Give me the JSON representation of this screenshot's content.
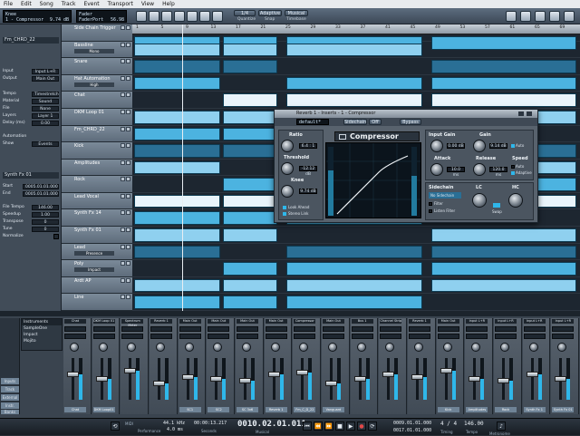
{
  "menu": [
    "File",
    "Edit",
    "Song",
    "Track",
    "Event",
    "Transport",
    "View",
    "Help"
  ],
  "toolbar": {
    "left_lcd_top": "Knee",
    "left_lcd_bottom": "1 - Compressor",
    "left_lcd_val": "9.74 dB",
    "mid_lcd_top": "Fader",
    "mid_lcd_bottom": "FaderPort",
    "mid_lcd_val": "56.98",
    "quantize_value": "1/4",
    "quantize_label": "Quantize",
    "snap_value": "Adaptive",
    "snap_label": "Snap",
    "timebase_value": "Musical",
    "timebase_label": "Timebase"
  },
  "inspector": {
    "channel_name": "Fm_CHRD_22",
    "input_label": "Input",
    "input_value": "Input L+R",
    "output_label": "Output",
    "output_value": "Main Out",
    "tempo_label": "Tempo",
    "tempo_value": "Timestretch",
    "material_label": "Material",
    "material_value": "Sound",
    "file_label": "File",
    "file_value": "None",
    "layers_label": "Layers",
    "layers_value": "Layer 1",
    "delay_label": "Delay (ms)",
    "delay_value": "0.00",
    "automation_label": "Automation",
    "show_label": "Show",
    "show_value": "Events",
    "event_name": "Synth Fx 01",
    "start_label": "Start",
    "start_value": "0005.01.01.000",
    "end_label": "End",
    "end_value": "0005.01.01.000",
    "filetempo_label": "File Tempo",
    "filetempo_value": "146.00",
    "speedup_label": "Speedup",
    "speedup_value": "1.00",
    "transpose_label": "Transpose",
    "transpose_value": "0",
    "tune_label": "Tune",
    "tune_value": "0",
    "normalize_label": "Normalize"
  },
  "tracks": [
    {
      "name": "Side Chain Trigger",
      "sub": ""
    },
    {
      "name": "Bassline",
      "sub": "Mono"
    },
    {
      "name": "Snare",
      "sub": ""
    },
    {
      "name": "Hat Automation",
      "sub": "High"
    },
    {
      "name": "Chat",
      "sub": ""
    },
    {
      "name": "DKM Loop 01",
      "sub": ""
    },
    {
      "name": "Fm_CHRD_22",
      "sub": ""
    },
    {
      "name": "Kick",
      "sub": ""
    },
    {
      "name": "Amplitudes",
      "sub": ""
    },
    {
      "name": "Rock",
      "sub": ""
    },
    {
      "name": "Lead Vocal",
      "sub": ""
    },
    {
      "name": "Synth Fx 14",
      "sub": ""
    },
    {
      "name": "Synth Fx 01",
      "sub": ""
    },
    {
      "name": "Lead",
      "sub": "Presence"
    },
    {
      "name": "Poly",
      "sub": "Impact"
    },
    {
      "name": "Ardt AP",
      "sub": ""
    },
    {
      "name": "Line",
      "sub": ""
    }
  ],
  "ruler": [
    "1",
    "5",
    "9",
    "13",
    "17",
    "21",
    "25",
    "29",
    "33",
    "37",
    "41",
    "45",
    "49",
    "53",
    "57",
    "61",
    "65",
    "69"
  ],
  "compressor": {
    "window_title": "Reverb 1 - Inserts - 1 - Compressor",
    "preset": "default*",
    "sidechain_btn": "Sidechain",
    "off_btn": "Off",
    "bypass_btn": "Bypass",
    "brand": "Compressor",
    "ratio_label": "Ratio",
    "ratio_value": "6.4 : 1",
    "threshold_label": "Threshold",
    "threshold_value": "-12.12 dB",
    "knee_label": "Knee",
    "knee_value": "9.74 dB",
    "look_ahead": "Look Ahead",
    "stereo_link": "Stereo Link",
    "input_gain_label": "Input Gain",
    "input_gain_value": "0.00 dB",
    "gain_label": "Gain",
    "gain_value": "9.14 dB",
    "auto_label": "Auto",
    "attack_label": "Attack",
    "attack_value": "10.0 ms",
    "release_label": "Release",
    "release_value": "120.0 ms",
    "speed_label": "Speed",
    "speed_auto": "Auto",
    "speed_adaptive": "Adaptive",
    "sidechain_label": "Sidechain",
    "no_sidechain": "No Sidechain",
    "filter_label": "Filter",
    "listen_filter": "Listen Filter",
    "lc_label": "LC",
    "hc_label": "HC",
    "swap_label": "Swap"
  },
  "mixer": {
    "left_panel": [
      "Instruments",
      "SampleOne",
      "Impact",
      "Mojito"
    ],
    "strips": [
      {
        "name": "Chat",
        "foot": "Chat",
        "level": 0.6
      },
      {
        "name": "DKM Loop 01",
        "foot": "DKM Loop01",
        "level": 0.5
      },
      {
        "name": "Spectrum Meter",
        "foot": "",
        "level": 0.7
      },
      {
        "name": "Reverb 1",
        "foot": "",
        "level": 0.4
      },
      {
        "name": "Main Out",
        "foot": "SC1",
        "level": 0.55
      },
      {
        "name": "Main Out",
        "foot": "SC2",
        "level": 0.5
      },
      {
        "name": "Main Out",
        "foot": "SC 3x6",
        "level": 0.45
      },
      {
        "name": "Main Out",
        "foot": "Reverb 1",
        "level": 0.6
      },
      {
        "name": "Compressor",
        "foot": "Fm_C_D_22",
        "level": 0.65
      },
      {
        "name": "Main Out",
        "foot": "Vanguard",
        "level": 0.4
      },
      {
        "name": "Bus 1",
        "foot": "",
        "level": 0.5
      },
      {
        "name": "Channel Strip",
        "foot": "",
        "level": 0.6
      },
      {
        "name": "Reverb 1",
        "foot": "",
        "level": 0.55
      },
      {
        "name": "Main Out",
        "foot": "Kick",
        "level": 0.7
      },
      {
        "name": "Input L+R",
        "foot": "Amplitudes",
        "level": 0.5
      },
      {
        "name": "Input L+R",
        "foot": "Rock",
        "level": 0.45
      },
      {
        "name": "Input L+R",
        "foot": "Synth Fx 1",
        "level": 0.6
      },
      {
        "name": "Input L+R",
        "foot": "Synth Fx 01",
        "level": 0.5
      }
    ],
    "left_nav": [
      "Inputs",
      "Track",
      "External",
      "Instr.",
      "Banks"
    ]
  },
  "transport": {
    "samplerate": "44.1 kHz",
    "latency": "4.0 ms",
    "time_seconds": "00:00:13.217",
    "seconds_label": "Seconds",
    "position": "0010.02.01.011",
    "bars_label": "Musical",
    "loop_start": "0009.01.01.000",
    "loop_end": "0017.01.01.000",
    "tempo": "4 / 4",
    "tempo_label": "Timing",
    "bpm": "146.00",
    "bpm_label": "Tempo",
    "metronome_label": "Metronome",
    "midi_label": "MIDI",
    "performance_label": "Performance"
  }
}
